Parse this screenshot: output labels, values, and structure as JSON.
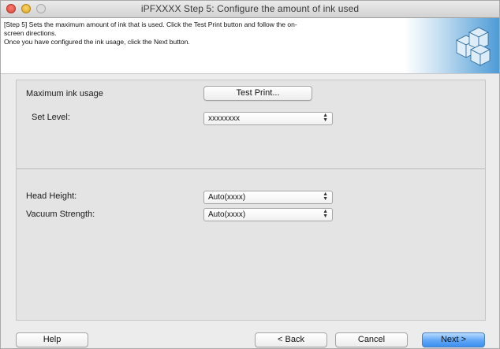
{
  "window": {
    "title": "iPFXXXX Step 5: Configure the amount of ink used"
  },
  "header": {
    "line1": "[Step 5] Sets the maximum amount of ink that is used. Click the Test Print button and follow the on-",
    "line2": "screen directions.",
    "line3": "Once you have configured the ink usage, click the Next button.",
    "art_icon": "printer-ink-cubes-icon"
  },
  "ink_section": {
    "max_ink_label": "Maximum ink usage",
    "test_print_label": "Test Print...",
    "set_level_label": "Set Level:",
    "set_level_value": "xxxxxxxx"
  },
  "media_section": {
    "head_height_label": "Head Height:",
    "head_height_value": "Auto(xxxx)",
    "vacuum_label": "Vacuum Strength:",
    "vacuum_value": "Auto(xxxx)"
  },
  "footer": {
    "help_label": "Help",
    "back_label": "< Back",
    "cancel_label": "Cancel",
    "next_label": "Next >"
  },
  "colors": {
    "default_button": "#4a95f2",
    "header_accent": "#4d9bd6"
  }
}
